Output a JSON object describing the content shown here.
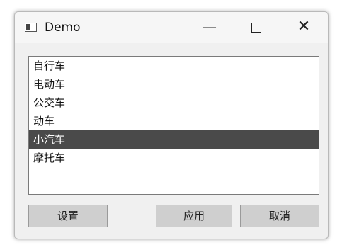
{
  "window": {
    "title": "Demo",
    "controls": {
      "minimize": "—",
      "close": "✕"
    }
  },
  "list": {
    "items": [
      {
        "label": "自行车",
        "selected": false
      },
      {
        "label": "电动车",
        "selected": false
      },
      {
        "label": "公交车",
        "selected": false
      },
      {
        "label": "动车",
        "selected": false
      },
      {
        "label": "小汽车",
        "selected": true
      },
      {
        "label": "摩托车",
        "selected": false
      }
    ],
    "selected_color": "#4a4a4a"
  },
  "buttons": {
    "settings": "设置",
    "apply": "应用",
    "cancel": "取消"
  }
}
